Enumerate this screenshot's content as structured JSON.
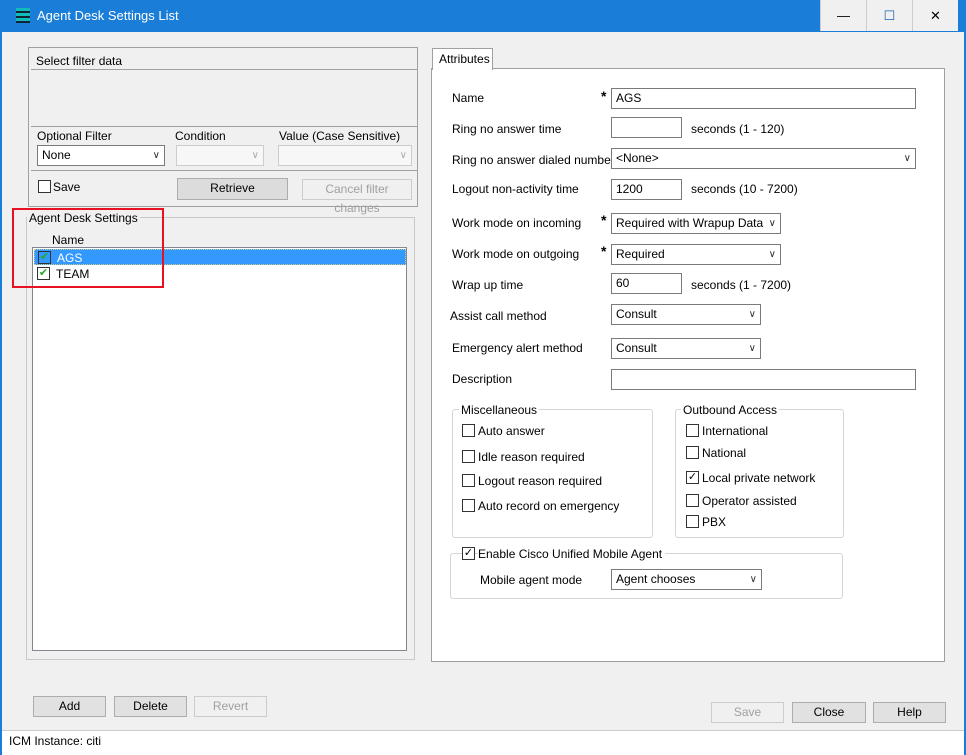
{
  "window": {
    "title": "Agent Desk Settings List",
    "icon": "app-stack-icon",
    "minimize": "—",
    "maximize": "☐",
    "close": "✕"
  },
  "filter": {
    "title": "Select filter data",
    "optional_filter_label": "Optional Filter",
    "optional_filter_value": "None",
    "condition_label": "Condition",
    "condition_value": "",
    "value_label": "Value (Case Sensitive)",
    "value_value": "",
    "save_label": "Save",
    "save_checked": false,
    "retrieve": "Retrieve",
    "cancel": "Cancel filter changes"
  },
  "list": {
    "title": "Agent Desk Settings",
    "column": "Name",
    "items": [
      {
        "name": "AGS",
        "selected": true
      },
      {
        "name": "TEAM",
        "selected": false
      }
    ],
    "highlight_color": "#e81123"
  },
  "list_buttons": {
    "add": "Add",
    "delete": "Delete",
    "revert": "Revert"
  },
  "tab": "Attributes",
  "attrs": {
    "name_label": "Name",
    "name_value": "AGS",
    "rna_label": "Ring no answer time",
    "rna_value": "",
    "rna_unit": "seconds (1 - 120)",
    "rnadn_label": "Ring no answer dialed number",
    "rnadn_value": "<None>",
    "logout_label": "Logout non-activity time",
    "logout_value": "1200",
    "logout_unit": "seconds (10 - 7200)",
    "wmi_label": "Work mode on incoming",
    "wmi_value": "Required with Wrapup Data",
    "wmo_label": "Work mode on outgoing",
    "wmo_value": "Required",
    "wrap_label": "Wrap up time",
    "wrap_value": "60",
    "wrap_unit": "seconds (1 - 7200)",
    "assist_label": "Assist call method",
    "assist_value": "Consult",
    "emerg_label": "Emergency alert method",
    "emerg_value": "Consult",
    "desc_label": "Description",
    "desc_value": "",
    "required_mark": "*"
  },
  "misc": {
    "title": "Miscellaneous",
    "items": [
      {
        "label": "Auto answer",
        "checked": false
      },
      {
        "label": "Idle reason required",
        "checked": false
      },
      {
        "label": "Logout reason required",
        "checked": false
      },
      {
        "label": "Auto record on emergency",
        "checked": false
      }
    ]
  },
  "outbound": {
    "title": "Outbound Access",
    "items": [
      {
        "label": "International",
        "checked": false
      },
      {
        "label": "National",
        "checked": false
      },
      {
        "label": "Local private network",
        "checked": true
      },
      {
        "label": "Operator assisted",
        "checked": false
      },
      {
        "label": "PBX",
        "checked": false
      }
    ]
  },
  "mobile": {
    "enable_label": "Enable Cisco Unified Mobile Agent",
    "enable_checked": true,
    "mode_label": "Mobile agent mode",
    "mode_value": "Agent chooses"
  },
  "footer": {
    "save": "Save",
    "close": "Close",
    "help": "Help"
  },
  "status": {
    "text": "ICM Instance: citi"
  }
}
